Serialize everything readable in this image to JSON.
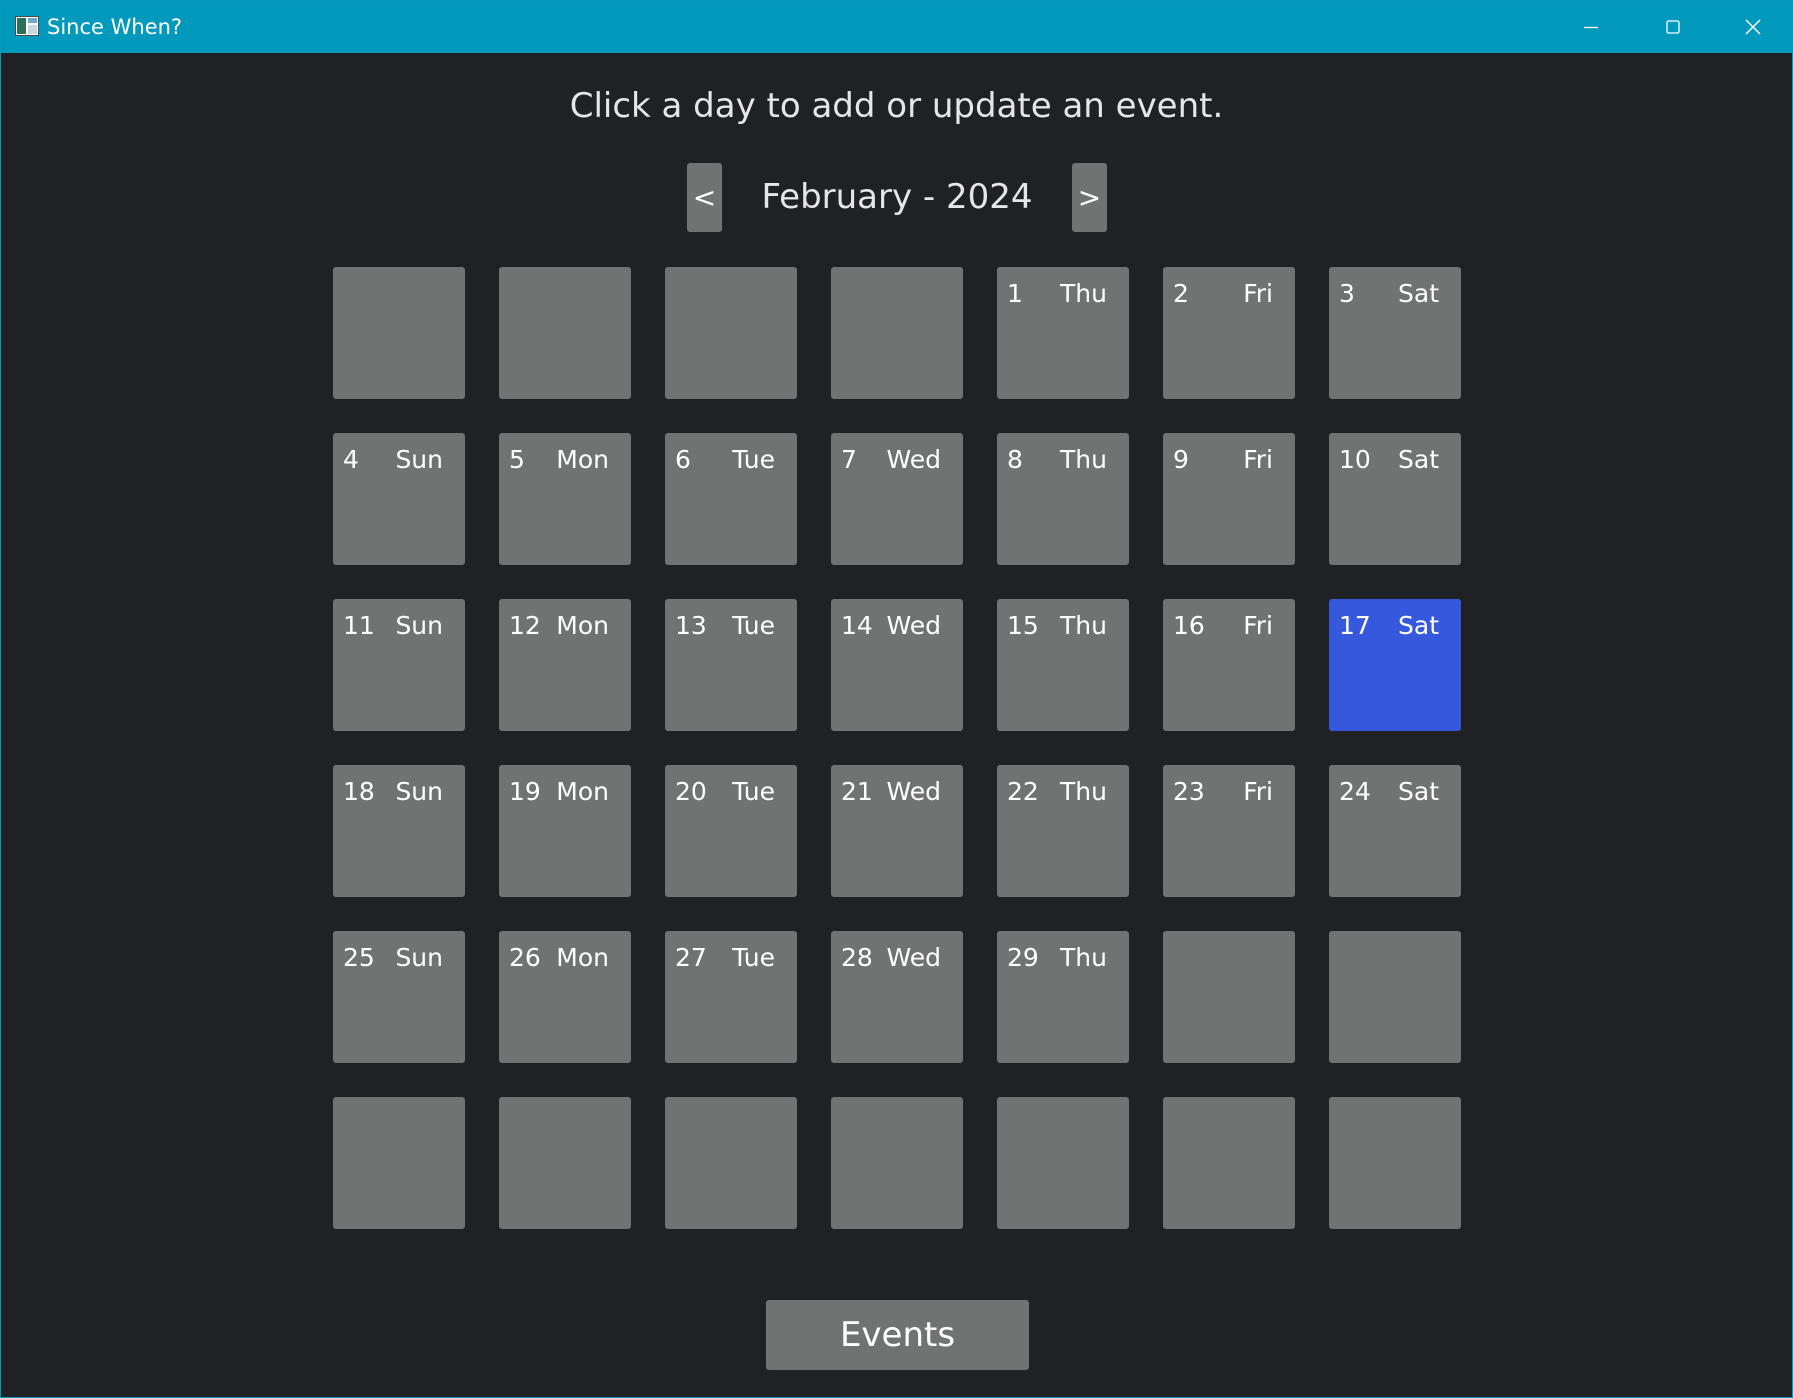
{
  "window": {
    "title": "Since When?",
    "controls": [
      "minimize-icon",
      "maximize-icon",
      "close-icon"
    ]
  },
  "instruction": "Click a day to add or update an event.",
  "nav": {
    "prev_label": "<",
    "month_label": "February - 2024",
    "next_label": ">"
  },
  "days": [
    {
      "num": "",
      "name": ""
    },
    {
      "num": "",
      "name": ""
    },
    {
      "num": "",
      "name": ""
    },
    {
      "num": "",
      "name": ""
    },
    {
      "num": "1",
      "name": "Thu"
    },
    {
      "num": "2",
      "name": "Fri"
    },
    {
      "num": "3",
      "name": "Sat"
    },
    {
      "num": "4",
      "name": "Sun"
    },
    {
      "num": "5",
      "name": "Mon"
    },
    {
      "num": "6",
      "name": "Tue"
    },
    {
      "num": "7",
      "name": "Wed"
    },
    {
      "num": "8",
      "name": "Thu"
    },
    {
      "num": "9",
      "name": "Fri"
    },
    {
      "num": "10",
      "name": "Sat"
    },
    {
      "num": "11",
      "name": "Sun"
    },
    {
      "num": "12",
      "name": "Mon"
    },
    {
      "num": "13",
      "name": "Tue"
    },
    {
      "num": "14",
      "name": "Wed"
    },
    {
      "num": "15",
      "name": "Thu"
    },
    {
      "num": "16",
      "name": "Fri"
    },
    {
      "num": "17",
      "name": "Sat",
      "selected": true
    },
    {
      "num": "18",
      "name": "Sun"
    },
    {
      "num": "19",
      "name": "Mon"
    },
    {
      "num": "20",
      "name": "Tue"
    },
    {
      "num": "21",
      "name": "Wed"
    },
    {
      "num": "22",
      "name": "Thu"
    },
    {
      "num": "23",
      "name": "Fri"
    },
    {
      "num": "24",
      "name": "Sat"
    },
    {
      "num": "25",
      "name": "Sun"
    },
    {
      "num": "26",
      "name": "Mon"
    },
    {
      "num": "27",
      "name": "Tue"
    },
    {
      "num": "28",
      "name": "Wed"
    },
    {
      "num": "29",
      "name": "Thu"
    },
    {
      "num": "",
      "name": ""
    },
    {
      "num": "",
      "name": ""
    },
    {
      "num": "",
      "name": ""
    },
    {
      "num": "",
      "name": ""
    },
    {
      "num": "",
      "name": ""
    },
    {
      "num": "",
      "name": ""
    },
    {
      "num": "",
      "name": ""
    },
    {
      "num": "",
      "name": ""
    },
    {
      "num": "",
      "name": ""
    }
  ],
  "events_button": "Events",
  "colors": {
    "titlebar": "#0399bc",
    "background": "#202124",
    "tile": "#717372",
    "selected_tile": "#3558dc"
  }
}
